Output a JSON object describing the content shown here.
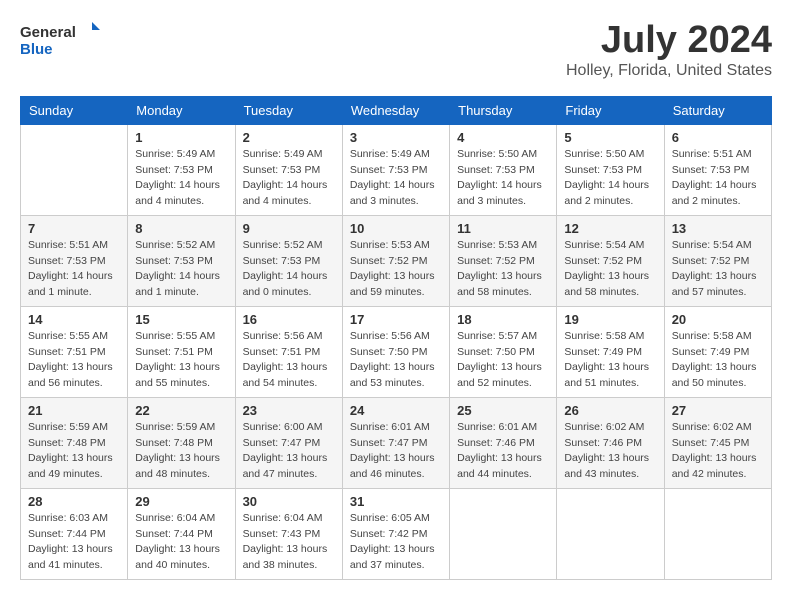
{
  "header": {
    "logo_general": "General",
    "logo_blue": "Blue",
    "title": "July 2024",
    "subtitle": "Holley, Florida, United States"
  },
  "days_of_week": [
    "Sunday",
    "Monday",
    "Tuesday",
    "Wednesday",
    "Thursday",
    "Friday",
    "Saturday"
  ],
  "weeks": [
    [
      {
        "day": "",
        "sunrise": "",
        "sunset": "",
        "daylight": ""
      },
      {
        "day": "1",
        "sunrise": "Sunrise: 5:49 AM",
        "sunset": "Sunset: 7:53 PM",
        "daylight": "Daylight: 14 hours and 4 minutes."
      },
      {
        "day": "2",
        "sunrise": "Sunrise: 5:49 AM",
        "sunset": "Sunset: 7:53 PM",
        "daylight": "Daylight: 14 hours and 4 minutes."
      },
      {
        "day": "3",
        "sunrise": "Sunrise: 5:49 AM",
        "sunset": "Sunset: 7:53 PM",
        "daylight": "Daylight: 14 hours and 3 minutes."
      },
      {
        "day": "4",
        "sunrise": "Sunrise: 5:50 AM",
        "sunset": "Sunset: 7:53 PM",
        "daylight": "Daylight: 14 hours and 3 minutes."
      },
      {
        "day": "5",
        "sunrise": "Sunrise: 5:50 AM",
        "sunset": "Sunset: 7:53 PM",
        "daylight": "Daylight: 14 hours and 2 minutes."
      },
      {
        "day": "6",
        "sunrise": "Sunrise: 5:51 AM",
        "sunset": "Sunset: 7:53 PM",
        "daylight": "Daylight: 14 hours and 2 minutes."
      }
    ],
    [
      {
        "day": "7",
        "sunrise": "Sunrise: 5:51 AM",
        "sunset": "Sunset: 7:53 PM",
        "daylight": "Daylight: 14 hours and 1 minute."
      },
      {
        "day": "8",
        "sunrise": "Sunrise: 5:52 AM",
        "sunset": "Sunset: 7:53 PM",
        "daylight": "Daylight: 14 hours and 1 minute."
      },
      {
        "day": "9",
        "sunrise": "Sunrise: 5:52 AM",
        "sunset": "Sunset: 7:53 PM",
        "daylight": "Daylight: 14 hours and 0 minutes."
      },
      {
        "day": "10",
        "sunrise": "Sunrise: 5:53 AM",
        "sunset": "Sunset: 7:52 PM",
        "daylight": "Daylight: 13 hours and 59 minutes."
      },
      {
        "day": "11",
        "sunrise": "Sunrise: 5:53 AM",
        "sunset": "Sunset: 7:52 PM",
        "daylight": "Daylight: 13 hours and 58 minutes."
      },
      {
        "day": "12",
        "sunrise": "Sunrise: 5:54 AM",
        "sunset": "Sunset: 7:52 PM",
        "daylight": "Daylight: 13 hours and 58 minutes."
      },
      {
        "day": "13",
        "sunrise": "Sunrise: 5:54 AM",
        "sunset": "Sunset: 7:52 PM",
        "daylight": "Daylight: 13 hours and 57 minutes."
      }
    ],
    [
      {
        "day": "14",
        "sunrise": "Sunrise: 5:55 AM",
        "sunset": "Sunset: 7:51 PM",
        "daylight": "Daylight: 13 hours and 56 minutes."
      },
      {
        "day": "15",
        "sunrise": "Sunrise: 5:55 AM",
        "sunset": "Sunset: 7:51 PM",
        "daylight": "Daylight: 13 hours and 55 minutes."
      },
      {
        "day": "16",
        "sunrise": "Sunrise: 5:56 AM",
        "sunset": "Sunset: 7:51 PM",
        "daylight": "Daylight: 13 hours and 54 minutes."
      },
      {
        "day": "17",
        "sunrise": "Sunrise: 5:56 AM",
        "sunset": "Sunset: 7:50 PM",
        "daylight": "Daylight: 13 hours and 53 minutes."
      },
      {
        "day": "18",
        "sunrise": "Sunrise: 5:57 AM",
        "sunset": "Sunset: 7:50 PM",
        "daylight": "Daylight: 13 hours and 52 minutes."
      },
      {
        "day": "19",
        "sunrise": "Sunrise: 5:58 AM",
        "sunset": "Sunset: 7:49 PM",
        "daylight": "Daylight: 13 hours and 51 minutes."
      },
      {
        "day": "20",
        "sunrise": "Sunrise: 5:58 AM",
        "sunset": "Sunset: 7:49 PM",
        "daylight": "Daylight: 13 hours and 50 minutes."
      }
    ],
    [
      {
        "day": "21",
        "sunrise": "Sunrise: 5:59 AM",
        "sunset": "Sunset: 7:48 PM",
        "daylight": "Daylight: 13 hours and 49 minutes."
      },
      {
        "day": "22",
        "sunrise": "Sunrise: 5:59 AM",
        "sunset": "Sunset: 7:48 PM",
        "daylight": "Daylight: 13 hours and 48 minutes."
      },
      {
        "day": "23",
        "sunrise": "Sunrise: 6:00 AM",
        "sunset": "Sunset: 7:47 PM",
        "daylight": "Daylight: 13 hours and 47 minutes."
      },
      {
        "day": "24",
        "sunrise": "Sunrise: 6:01 AM",
        "sunset": "Sunset: 7:47 PM",
        "daylight": "Daylight: 13 hours and 46 minutes."
      },
      {
        "day": "25",
        "sunrise": "Sunrise: 6:01 AM",
        "sunset": "Sunset: 7:46 PM",
        "daylight": "Daylight: 13 hours and 44 minutes."
      },
      {
        "day": "26",
        "sunrise": "Sunrise: 6:02 AM",
        "sunset": "Sunset: 7:46 PM",
        "daylight": "Daylight: 13 hours and 43 minutes."
      },
      {
        "day": "27",
        "sunrise": "Sunrise: 6:02 AM",
        "sunset": "Sunset: 7:45 PM",
        "daylight": "Daylight: 13 hours and 42 minutes."
      }
    ],
    [
      {
        "day": "28",
        "sunrise": "Sunrise: 6:03 AM",
        "sunset": "Sunset: 7:44 PM",
        "daylight": "Daylight: 13 hours and 41 minutes."
      },
      {
        "day": "29",
        "sunrise": "Sunrise: 6:04 AM",
        "sunset": "Sunset: 7:44 PM",
        "daylight": "Daylight: 13 hours and 40 minutes."
      },
      {
        "day": "30",
        "sunrise": "Sunrise: 6:04 AM",
        "sunset": "Sunset: 7:43 PM",
        "daylight": "Daylight: 13 hours and 38 minutes."
      },
      {
        "day": "31",
        "sunrise": "Sunrise: 6:05 AM",
        "sunset": "Sunset: 7:42 PM",
        "daylight": "Daylight: 13 hours and 37 minutes."
      },
      {
        "day": "",
        "sunrise": "",
        "sunset": "",
        "daylight": ""
      },
      {
        "day": "",
        "sunrise": "",
        "sunset": "",
        "daylight": ""
      },
      {
        "day": "",
        "sunrise": "",
        "sunset": "",
        "daylight": ""
      }
    ]
  ]
}
